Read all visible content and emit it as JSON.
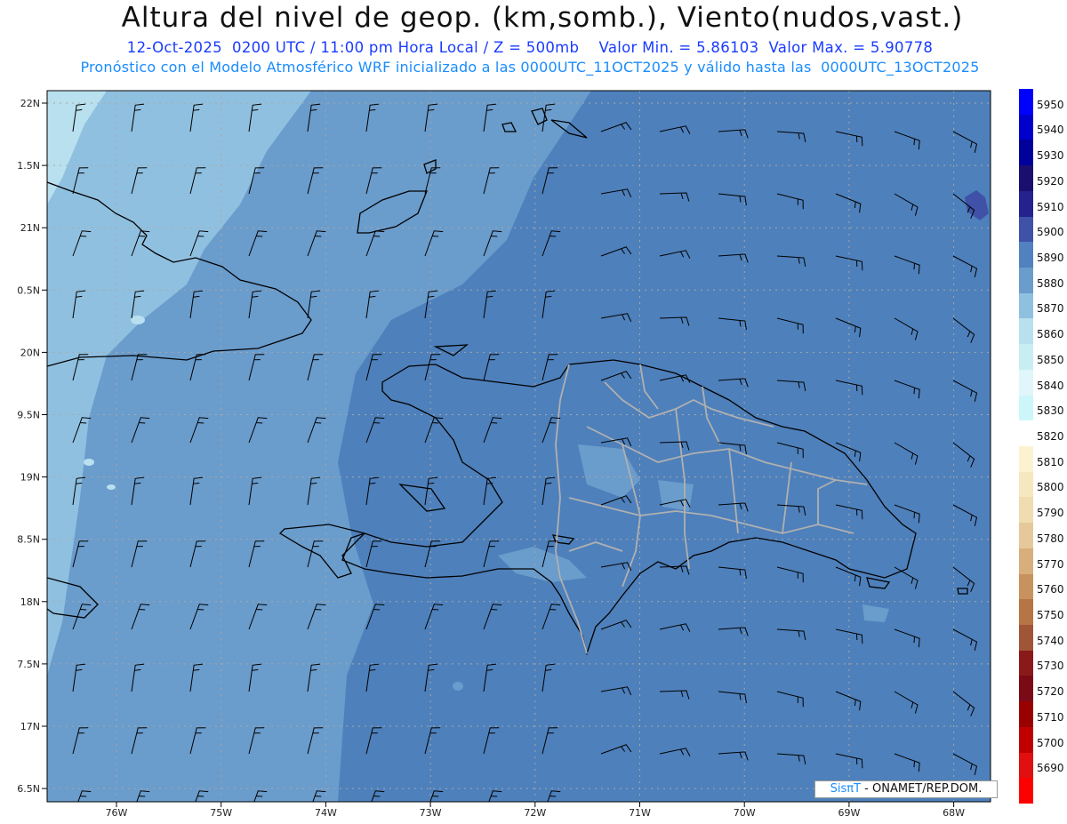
{
  "title": "Altura del nivel de geop. (km,somb.), Viento(nudos,vast.)",
  "subtitle_line1": "12-Oct-2025  0200 UTC / 11:00 pm Hora Local / Z = 500mb    Valor Min. = 5.86103  Valor Max. = 5.90778",
  "subtitle_line2": "Pronóstico con el Modelo Atmosférico WRF inicializado a las 0000UTC_11OCT2025 y válido hasta las  0000UTC_13OCT2025",
  "credit": {
    "brand": "SisπΤ",
    "sep": " - ",
    "org": "ONAMET/REP.DOM."
  },
  "lat_labels": [
    "22N",
    "1.5N",
    "21N",
    "0.5N",
    "20N",
    "9.5N",
    "19N",
    "8.5N",
    "18N",
    "7.5N",
    "17N",
    "6.5N"
  ],
  "lon_labels": [
    "76W",
    "75W",
    "74W",
    "73W",
    "72W",
    "71W",
    "70W",
    "69W",
    "68W"
  ],
  "colorbar": {
    "levels": [
      5950,
      5940,
      5930,
      5920,
      5910,
      5900,
      5890,
      5880,
      5870,
      5860,
      5850,
      5840,
      5830,
      5820,
      5810,
      5800,
      5790,
      5780,
      5770,
      5760,
      5750,
      5740,
      5730,
      5720,
      5710,
      5700,
      5690
    ],
    "colors": [
      "#0000ff",
      "#0000cc",
      "#00009a",
      "#1a0f6e",
      "#23228f",
      "#3f52a8",
      "#5281bf",
      "#6a9ccc",
      "#90c0e0",
      "#b8e0ee",
      "#c8eef4",
      "#e0f6fa",
      "#cdf6fa",
      "#ffffff",
      "#fbf3d0",
      "#f5e8bf",
      "#efdcb0",
      "#e6c99a",
      "#d8ae7c",
      "#c8925e",
      "#b77445",
      "#a05536",
      "#8a1a1a",
      "#7a0a16",
      "#990000",
      "#c00000",
      "#e01010",
      "#ff0000"
    ]
  },
  "fields": {
    "deep": "#4e80bb",
    "mid": "#6a9ccc",
    "light": "#90c0e0",
    "pale": "#b8e0ee",
    "dark_patch": "#3f52a8"
  }
}
